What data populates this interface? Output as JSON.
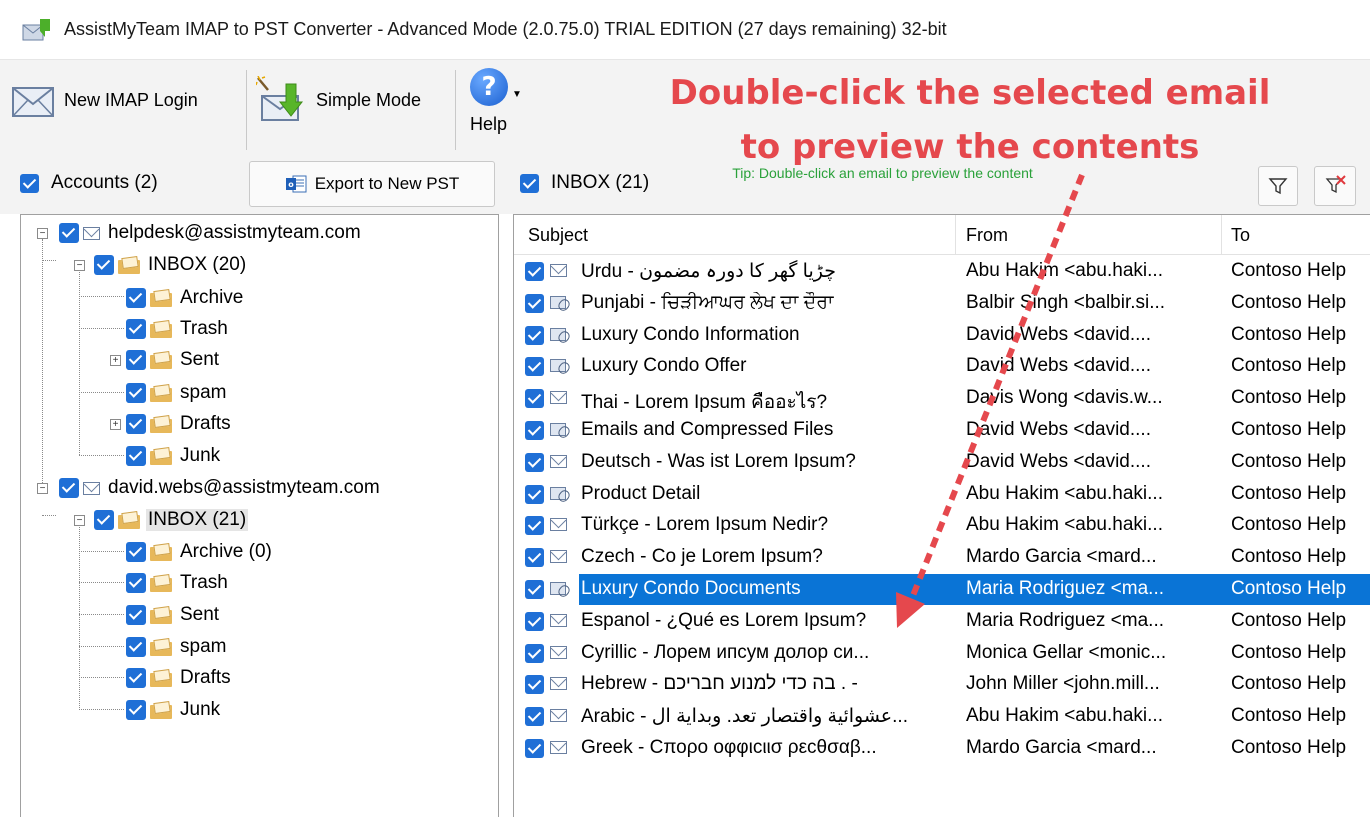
{
  "window": {
    "title": "AssistMyTeam IMAP to PST Converter - Advanced Mode (2.0.75.0) TRIAL EDITION (27 days remaining) 32-bit"
  },
  "ribbon": {
    "new_imap_login": "New IMAP Login",
    "simple_mode": "Simple Mode",
    "help": "Help"
  },
  "annotation": {
    "line1": "Double-click the selected email",
    "line2": "to preview the contents",
    "color": "#e5484d"
  },
  "toolbar": {
    "accounts_label": "Accounts (2)",
    "export_label": "Export to New PST",
    "inbox_label": "INBOX (21)",
    "tip": "Tip: Double-click an email to preview the content"
  },
  "tree": {
    "accounts": [
      {
        "email": "helpdesk@assistmyteam.com",
        "folders": [
          {
            "label": "INBOX (20)"
          },
          {
            "label": "Archive"
          },
          {
            "label": "Trash"
          },
          {
            "label": "Sent"
          },
          {
            "label": "spam"
          },
          {
            "label": "Drafts"
          },
          {
            "label": "Junk"
          }
        ]
      },
      {
        "email": "david.webs@assistmyteam.com",
        "folders": [
          {
            "label": "INBOX (21)"
          },
          {
            "label": "Archive (0)"
          },
          {
            "label": "Trash"
          },
          {
            "label": "Sent"
          },
          {
            "label": "spam"
          },
          {
            "label": "Drafts"
          },
          {
            "label": "Junk"
          }
        ]
      }
    ]
  },
  "list": {
    "columns": {
      "subject": "Subject",
      "from": "From",
      "to": "To"
    },
    "rows": [
      {
        "subject": "Urdu - چڑیا گھر کا دورہ مضمون",
        "from": "Abu Hakim <abu.haki...",
        "to": "Contoso Help",
        "icon": "envelope-icon"
      },
      {
        "subject": "Punjabi - ਚਿੜੀਆਘਰ ਲੇਖ ਦਾ ਦੌਰਾ",
        "from": "Balbir Singh <balbir.si...",
        "to": "Contoso Help",
        "icon": "attachment-envelope-icon"
      },
      {
        "subject": "Luxury Condo Information",
        "from": "David Webs <david....",
        "to": "Contoso Help",
        "icon": "attachment-envelope-icon"
      },
      {
        "subject": "Luxury Condo Offer",
        "from": "David Webs <david....",
        "to": "Contoso Help",
        "icon": "attachment-envelope-icon"
      },
      {
        "subject": "Thai - Lorem Ipsum คืออะไร?",
        "from": "Davis Wong <davis.w...",
        "to": "Contoso Help",
        "icon": "envelope-icon"
      },
      {
        "subject": "Emails and Compressed Files",
        "from": "David Webs <david....",
        "to": "Contoso Help",
        "icon": "attachment-envelope-icon"
      },
      {
        "subject": "Deutsch - Was ist Lorem Ipsum?",
        "from": "David Webs <david....",
        "to": "Contoso Help",
        "icon": "envelope-icon"
      },
      {
        "subject": "Product Detail",
        "from": "Abu Hakim <abu.haki...",
        "to": "Contoso Help",
        "icon": "attachment-envelope-icon"
      },
      {
        "subject": "Türkçe - Lorem Ipsum Nedir?",
        "from": "Abu Hakim <abu.haki...",
        "to": "Contoso Help",
        "icon": "envelope-icon"
      },
      {
        "subject": "Czech - Co je Lorem Ipsum?",
        "from": "Mardo Garcia <mard...",
        "to": "Contoso Help",
        "icon": "envelope-icon"
      },
      {
        "subject": "Luxury Condo Documents",
        "from": "Maria Rodriguez <ma...",
        "to": "Contoso Help",
        "icon": "attachment-envelope-icon"
      },
      {
        "subject": "Espanol - ¿Qué es Lorem Ipsum?",
        "from": "Maria Rodriguez <ma...",
        "to": "Contoso Help",
        "icon": "envelope-icon"
      },
      {
        "subject": "Cyrillic - Лорем ипсум долор си...",
        "from": "Monica Gellar <monic...",
        "to": "Contoso Help",
        "icon": "envelope-icon"
      },
      {
        "subject": "Hebrew - בה כדי למנוע חבריכם . -",
        "from": "John Miller <john.mill...",
        "to": "Contoso Help",
        "icon": "envelope-icon"
      },
      {
        "subject": "Arabic - عشوائية واقتصار تعد. وبداية ال...",
        "from": "Abu Hakim <abu.haki...",
        "to": "Contoso Help",
        "icon": "envelope-icon"
      },
      {
        "subject": "Greek - Cπορο οφφιcιισ ρεcθσαβ...",
        "from": "Mardo Garcia <mard...",
        "to": "Contoso Help",
        "icon": "envelope-icon"
      }
    ],
    "selected_index": 10,
    "selection_color": "#0a74d6"
  },
  "colors": {
    "checkbox": "#1f6fd6",
    "tip": "#2aa13a"
  }
}
